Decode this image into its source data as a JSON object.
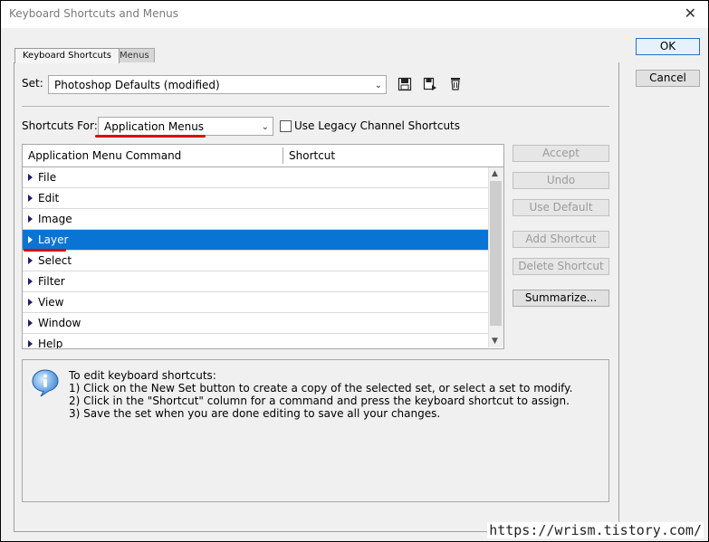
{
  "window": {
    "title": "Keyboard Shortcuts and Menus",
    "close": "✕"
  },
  "tabs": [
    {
      "label": "Keyboard Shortcuts",
      "active": true
    },
    {
      "label": "Menus",
      "active": false
    }
  ],
  "set": {
    "label": "Set:",
    "value": "Photoshop Defaults (modified)"
  },
  "shortcuts_for": {
    "label": "Shortcuts For:",
    "value": "Application Menus",
    "legacy_label": "Use Legacy Channel Shortcuts",
    "legacy_checked": false
  },
  "table": {
    "headers": [
      "Application Menu Command",
      "Shortcut"
    ],
    "rows": [
      "File",
      "Edit",
      "Image",
      "Layer",
      "Select",
      "Filter",
      "View",
      "Window",
      "Help"
    ],
    "selected": "Layer"
  },
  "side_buttons": {
    "accept": "Accept",
    "undo": "Undo",
    "use_default": "Use Default",
    "add_shortcut": "Add Shortcut",
    "delete_shortcut": "Delete Shortcut",
    "summarize": "Summarize..."
  },
  "dialog_buttons": {
    "ok": "OK",
    "cancel": "Cancel"
  },
  "info": {
    "lines": [
      "To edit keyboard shortcuts:",
      "1) Click on the New Set button to create a copy of the selected set, or select a set to modify.",
      "2) Click in the \"Shortcut\" column for a command and press the keyboard shortcut to assign.",
      "3) Save the set when you are done editing to save all your changes."
    ]
  },
  "watermark": "https://wrism.tistory.com/",
  "colors": {
    "selection": "#0a74d4",
    "annotation": "#e00000",
    "info_icon": "#2f7fd0"
  }
}
